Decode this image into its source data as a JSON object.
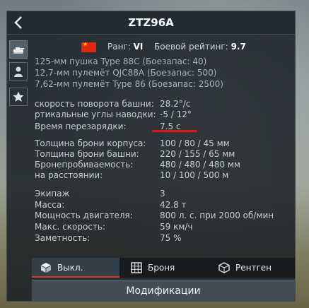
{
  "title": "ZTZ96A",
  "nation": {
    "flag_icon": "china-flag-icon",
    "color": "#de2910",
    "star_color": "#ffde00"
  },
  "rank": {
    "label": "Ранг:",
    "value": "VI"
  },
  "battle_rating": {
    "label": "Боевой рейтинг:",
    "value": "9.7"
  },
  "side_tabs": [
    {
      "name": "tank-icon"
    },
    {
      "name": "crew-icon"
    },
    {
      "name": "star-icon"
    }
  ],
  "weapons": [
    "125-мм пушка Type 88C (Боезапас: 40)",
    "12,7-мм пулемёт QJC88A (Боезапас: 500)",
    "7,62-мм пулемёт Type 86 (Боезапас: 2500)"
  ],
  "stats": {
    "turret_speed": {
      "label": "скорость поворота башни:",
      "value": "28.2°/c"
    },
    "vertical_angles": {
      "label": "ртикальные углы наводки:",
      "value": "-5 / 12°"
    },
    "reload": {
      "label": "Время перезарядки:",
      "value": "7.5 с"
    },
    "hull_armor": {
      "label": "Толщина брони корпуса:",
      "value": "100 / 80 / 45 мм"
    },
    "turret_armor": {
      "label": "Толщина брони башни:",
      "value": "220 / 155 / 65 мм"
    },
    "penetration": {
      "label": "Бронепробиваемость:",
      "value": "480 / 480 / 480 мм"
    },
    "distance": {
      "label": "на расстоянии:",
      "value": "10 / 100 / 500 м"
    },
    "crew": {
      "label": "Экипаж",
      "value": "3"
    },
    "mass": {
      "label": "Масса:",
      "value": "42.8 т"
    },
    "engine_power": {
      "label": "Мощность двигателя:",
      "value": "800 л. с. при 2000 об/мин"
    },
    "max_speed": {
      "label": "Макс. скорость:",
      "value": "59 км/ч"
    },
    "visibility": {
      "label": "Заметность:",
      "value": "75 %"
    }
  },
  "modes": [
    {
      "label": "Выкл.",
      "icon": "cube-icon",
      "active": true
    },
    {
      "label": "Броня",
      "icon": "armor-icon",
      "active": false
    },
    {
      "label": "Рентген",
      "icon": "xray-icon",
      "active": false
    }
  ],
  "modifications_label": "Модификации",
  "accent_color": "#e0161b"
}
